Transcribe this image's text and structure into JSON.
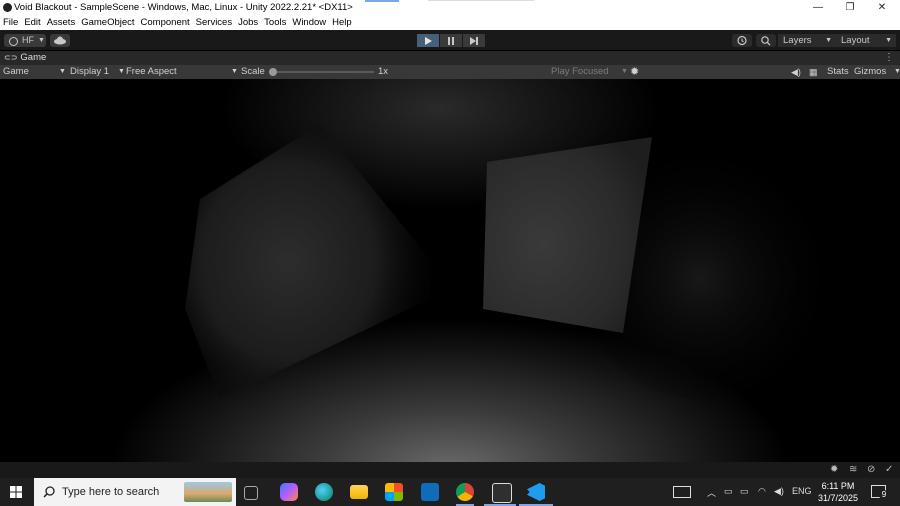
{
  "window": {
    "title": "Void Blackout - SampleScene - Windows, Mac, Linux - Unity 2022.2.21* <DX11>",
    "minimize": "—",
    "maximize": "❐",
    "close": "✕"
  },
  "menu": [
    "File",
    "Edit",
    "Assets",
    "GameObject",
    "Component",
    "Services",
    "Jobs",
    "Tools",
    "Window",
    "Help"
  ],
  "toolbar": {
    "account_label": "HF",
    "layers_label": "Layers",
    "layout_label": "Layout"
  },
  "game_view": {
    "tab_label": "Game",
    "view_mode": "Game",
    "display": "Display 1",
    "aspect": "Free Aspect",
    "scale_label": "Scale",
    "scale_value": "1x",
    "play_focused": "Play Focused",
    "stats_label": "Stats",
    "gizmos_label": "Gizmos"
  },
  "taskbar": {
    "search_placeholder": "Type here to search",
    "language": "ENG",
    "time": "6:11 PM",
    "date": "31/7/2025",
    "notification_count": "9"
  },
  "colors": {
    "play_active": "#46607c",
    "toolbar_bg": "#191919",
    "taskbar_bg": "#1f1f1f"
  }
}
